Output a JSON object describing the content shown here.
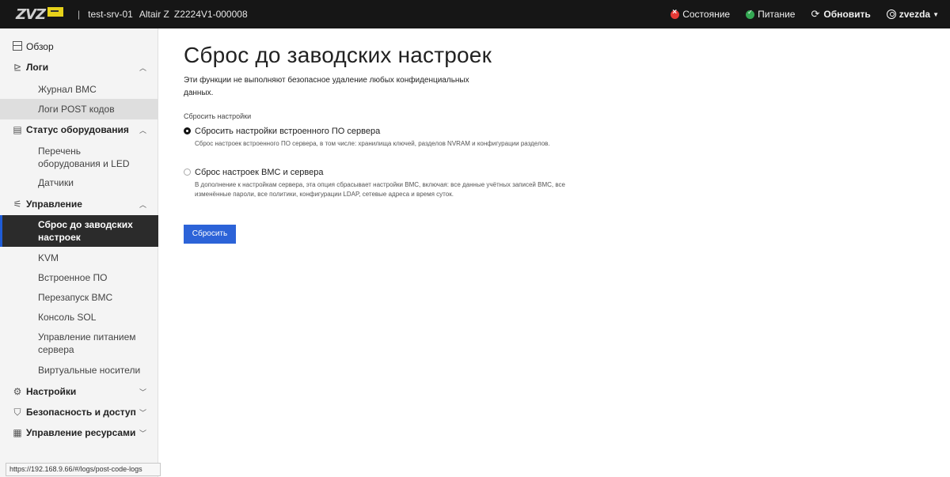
{
  "header": {
    "separator": "|",
    "hostname": "test-srv-01",
    "model": "Altair Z",
    "serial": "Z2224V1-000008",
    "health_label": "Состояние",
    "power_label": "Питание",
    "refresh_label": "Обновить",
    "user_label": "zvezda",
    "colors": {
      "bg": "#161616",
      "health": "#e53935",
      "power": "#34a853"
    }
  },
  "sidebar": {
    "overview": "Обзор",
    "logs": "Логи",
    "logs_items": [
      "Журнал BMC",
      "Логи POST кодов"
    ],
    "hardware": "Статус оборудования",
    "hardware_items": [
      "Перечень оборудования и LED",
      "Датчики"
    ],
    "control": "Управление",
    "control_items": [
      "Сброс до заводских настроек",
      "KVM",
      "Встроенное ПО",
      "Перезапуск BMC",
      "Консоль SOL",
      "Управление питанием сервера",
      "Виртуальные носители"
    ],
    "settings": "Настройки",
    "security": "Безопасность и доступ",
    "resources": "Управление ресурсами"
  },
  "status_url": "https://192.168.9.66/#/logs/post-code-logs",
  "main": {
    "title": "Сброс до заводских настроек",
    "lead": "Эти функции не выполняют безопасное удаление любых конфиденциальных данных.",
    "group_label": "Сбросить настройки",
    "options": [
      {
        "label": "Сбросить настройки встроенного ПО сервера",
        "help": "Сброс настроек встроенного ПО сервера, в том числе: хранилища ключей, разделов NVRAM и конфигурации разделов.",
        "selected": true
      },
      {
        "label": "Сброс настроек BMC и сервера",
        "help": "В дополнение к настройкам сервера, эта опция сбрасывает настройки BMC, включая: все данные учётных записей BMC, все изменённые пароли, все политики, конфигурации LDAP, сетевые адреса и время суток.",
        "selected": false
      }
    ],
    "reset_button": "Сбросить",
    "accent_color": "#2c63d8"
  }
}
